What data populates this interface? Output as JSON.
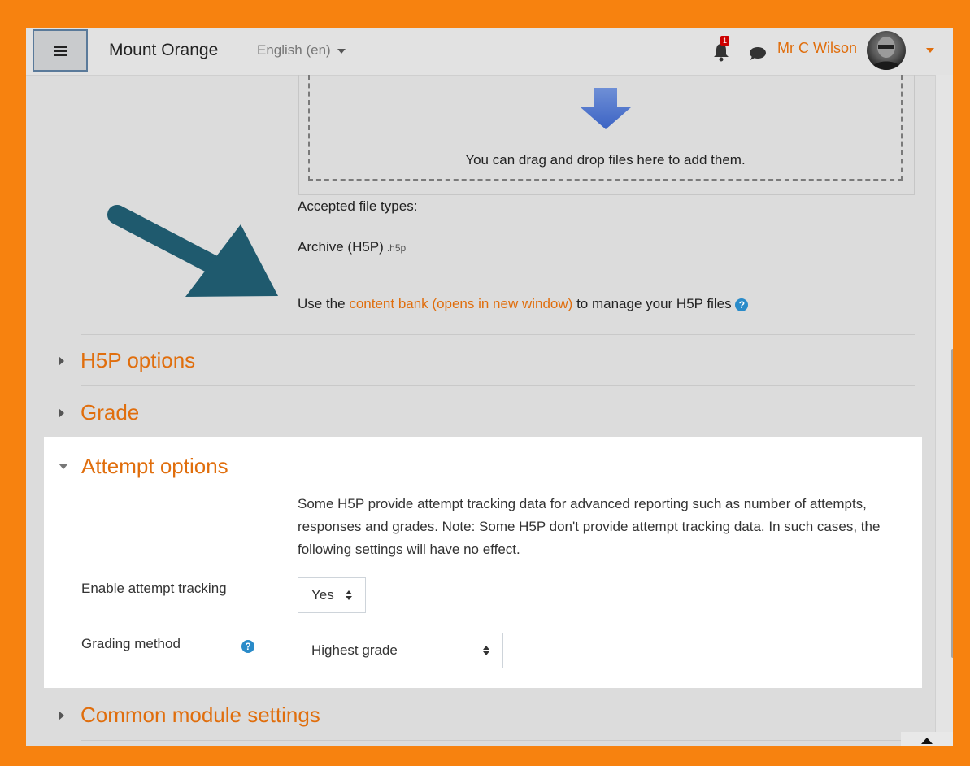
{
  "navbar": {
    "brand": "Mount Orange",
    "language": "English (en)",
    "notification_count": "1",
    "username": "Mr C Wilson"
  },
  "dropzone": {
    "text": "You can drag and drop files here to add them."
  },
  "files": {
    "accepted_label": "Accepted file types:",
    "type_name": "Archive (H5P)",
    "type_ext": ".h5p",
    "manage_prefix": "Use the",
    "manage_link": "content bank (opens in new window)",
    "manage_suffix": "to manage your H5P files"
  },
  "sections": {
    "h5p_options": "H5P options",
    "grade": "Grade",
    "attempt_options": "Attempt options",
    "common_module": "Common module settings"
  },
  "attempt": {
    "description": "Some H5P provide attempt tracking data for advanced reporting such as number of attempts, responses and grades. Note: Some H5P don't provide attempt tracking data. In such cases, the following settings will have no effect.",
    "tracking_label": "Enable attempt tracking",
    "tracking_value": "Yes",
    "grading_label": "Grading method",
    "grading_value": "Highest grade"
  },
  "colors": {
    "accent": "#e06e0d",
    "border": "#f7820f",
    "help": "#2a8bc9",
    "callout_arrow": "#1f5a6e"
  }
}
